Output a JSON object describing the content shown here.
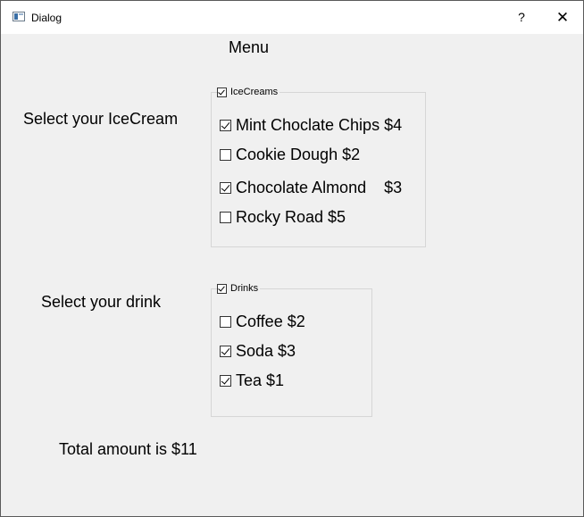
{
  "window": {
    "title": "Dialog",
    "help_label": "?",
    "close_label": "✕"
  },
  "menu_heading": "Menu",
  "icecream": {
    "prompt": "Select your IceCream",
    "group_title": "IceCreams",
    "group_checked": true,
    "items": [
      {
        "label": "Mint Choclate Chips $4",
        "checked": true
      },
      {
        "label": "Cookie Dough $2",
        "checked": false
      },
      {
        "label": "Chocolate Almond    $3",
        "checked": true
      },
      {
        "label": "Rocky Road $5",
        "checked": false
      }
    ]
  },
  "drinks": {
    "prompt": "Select your drink",
    "group_title": "Drinks",
    "group_checked": true,
    "items": [
      {
        "label": "Coffee $2",
        "checked": false
      },
      {
        "label": "Soda $3",
        "checked": true
      },
      {
        "label": "Tea $1",
        "checked": true
      }
    ]
  },
  "total": "Total amount is $11"
}
